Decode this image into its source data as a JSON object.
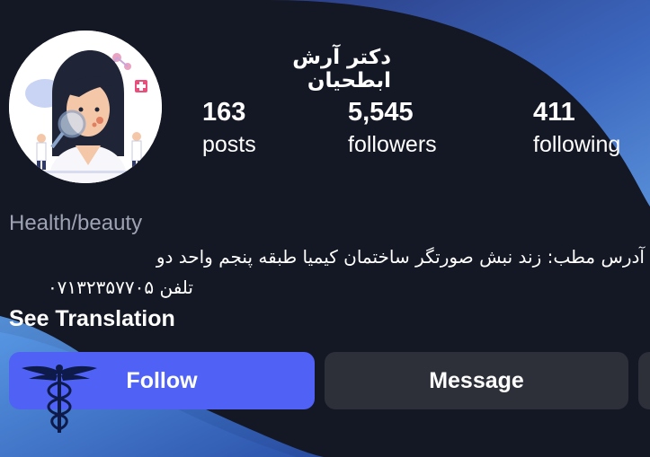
{
  "profile": {
    "username": "دکتر آرش ابطحیان",
    "stats": [
      {
        "value": "163",
        "label": "posts"
      },
      {
        "value": "5,545",
        "label": "followers"
      },
      {
        "value": "411",
        "label": "following"
      }
    ]
  },
  "bio": {
    "category": "Health/beauty",
    "line1": "آدرس مطب: زند نبش صورتگر ساختمان کیمیا طبقه پنجم واحد دو",
    "line2": "تلفن ۰۷۱۳۲۳۵۷۷۰۵",
    "see_translation": "See Translation"
  },
  "actions": {
    "follow_label": "Follow",
    "message_label": "Message"
  },
  "colors": {
    "background": "#141724",
    "follow_button": "#4f62f5",
    "message_button": "#2d2f39",
    "category_text": "#9ea3b3",
    "swoosh_blue": "#3d78d6"
  }
}
